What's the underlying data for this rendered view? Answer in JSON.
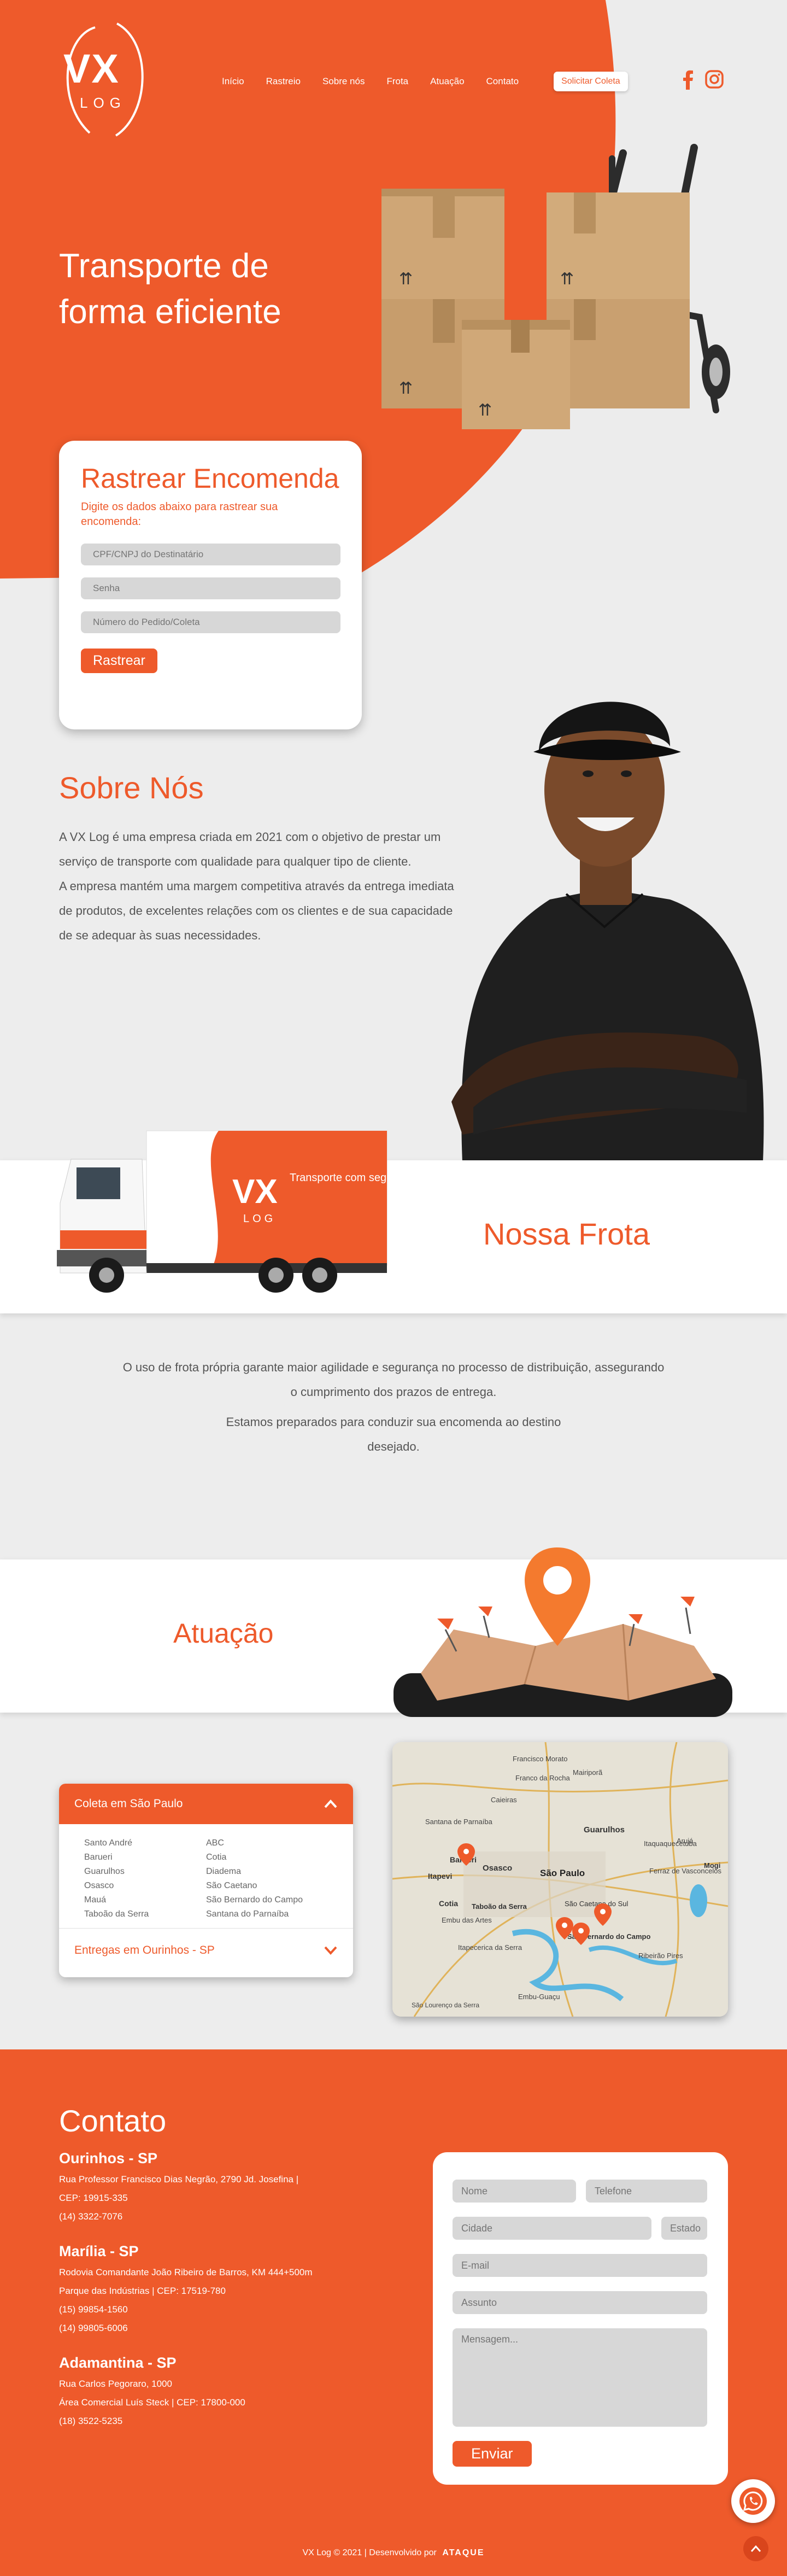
{
  "brand": {
    "logo_main": "VX",
    "logo_sub": "LOG",
    "accent": "#ee5a2b"
  },
  "nav": {
    "items": [
      "Início",
      "Rastreio",
      "Sobre nós",
      "Frota",
      "Atuação",
      "Contato"
    ],
    "cta": "Solicitar Coleta",
    "social": [
      "facebook-icon",
      "instagram-icon"
    ]
  },
  "hero": {
    "title": "Transporte de forma eficiente"
  },
  "track": {
    "title": "Rastrear Encomenda",
    "subtitle": "Digite os dados abaixo para rastrear sua encomenda:",
    "field_doc": "CPF/CNPJ do Destinatário",
    "field_password": "Senha",
    "field_order": "Número do Pedido/Coleta",
    "button": "Rastrear"
  },
  "about": {
    "title": "Sobre Nós",
    "p1": "A VX Log é uma empresa criada em 2021 com o objetivo de prestar um serviço de transporte com qualidade para qualquer tipo de cliente.",
    "p2": "A empresa mantém uma margem competitiva através da entrega imediata de produtos, de excelentes relações com os clientes e de sua capacidade de se adequar às suas necessidades."
  },
  "fleet": {
    "title": "Nossa Frota",
    "truck_logo": "VX",
    "truck_logo_sub": "LOG",
    "truck_slogan": "Transporte com segurança",
    "p1": "O uso de frota própria garante maior agilidade e segurança no processo de distribuição, assegurando o cumprimento dos prazos de entrega.",
    "p2": "Estamos preparados para conduzir sua encomenda ao destino desejado."
  },
  "coverage": {
    "title": "Atuação",
    "acc1_title": "Coleta em São Paulo",
    "col1": [
      "Santo André",
      "Barueri",
      "Guarulhos",
      "Osasco",
      "Mauá",
      "Taboão da Serra"
    ],
    "col2": [
      "ABC",
      "Cotia",
      "Diadema",
      "São Caetano",
      "São Bernardo do Campo",
      "Santana do Parnaíba"
    ],
    "acc2_title": "Entregas em Ourinhos - SP",
    "map_labels": [
      "Francisco Morato",
      "Franco da Rocha",
      "Caieiras",
      "Mairiporã",
      "Guarulhos",
      "Arujá",
      "Santana de Parnaíba",
      "Barueri",
      "Osasco",
      "São Paulo",
      "Itaquaquecetuba",
      "Itapevi",
      "Ferraz de Vasconcelos",
      "Mogi",
      "Cotia",
      "Taboão da Serra",
      "São Caetano do Sul",
      "Embu das Artes",
      "São Bernardo do Campo",
      "Itapecerica da Serra",
      "Ribeirão Pires",
      "Embu-Guaçu",
      "São Lourenço da Serra"
    ]
  },
  "contact": {
    "title": "Contato",
    "offices": [
      {
        "city": "Ourinhos - SP",
        "lines": [
          "Rua Professor Francisco Dias Negrão, 2790 Jd. Josefina |",
          "CEP: 19915-335",
          "(14) 3322-7076"
        ]
      },
      {
        "city": "Marília - SP",
        "lines": [
          "Rodovia Comandante João Ribeiro de Barros, KM 444+500m",
          "Parque das Indústrias | CEP: 17519-780",
          "(15) 99854-1560",
          "(14) 99805-6006"
        ]
      },
      {
        "city": "Adamantina - SP",
        "lines": [
          "Rua Carlos Pegoraro, 1000",
          "Área Comercial Luís Steck | CEP: 17800-000",
          "(18) 3522-5235"
        ]
      }
    ],
    "form": {
      "name": "Nome",
      "phone": "Telefone",
      "city": "Cidade",
      "state": "Estado",
      "email": "E-mail",
      "subject": "Assunto",
      "message": "Mensagem...",
      "button": "Enviar"
    }
  },
  "footer": {
    "text": "VX Log © 2021 | Desenvolvido por",
    "dev": "ATAQUE"
  }
}
